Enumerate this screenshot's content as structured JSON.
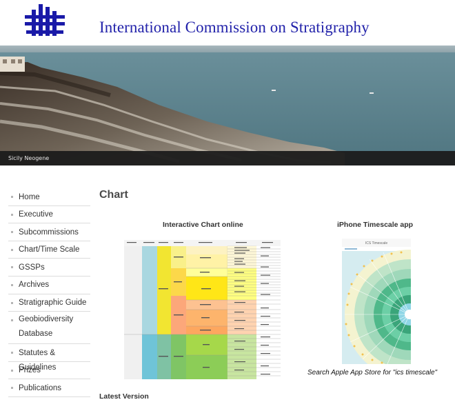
{
  "header": {
    "site_title": "International Commission on Stratigraphy"
  },
  "banner": {
    "caption": "Sicily Neogene"
  },
  "sidebar": {
    "items": [
      {
        "label": "Home"
      },
      {
        "label": "Executive"
      },
      {
        "label": "Subcommissions"
      },
      {
        "label": "Chart/Time Scale"
      },
      {
        "label": "GSSPs"
      },
      {
        "label": "Archives"
      },
      {
        "label": "Stratigraphic Guide"
      },
      {
        "label": "Geobiodiversity Database"
      },
      {
        "label": "Statutes & Guidelines"
      },
      {
        "label": "Prizes"
      },
      {
        "label": "Publications"
      }
    ]
  },
  "main": {
    "title": "Chart",
    "interactive_heading": "Interactive Chart online",
    "iphone_heading": "iPhone Timescale app",
    "app_caption": "Search Apple App Store for \"ics timescale\"",
    "app_screen_title": "ICS Timescale",
    "latest_heading": "Latest Version"
  },
  "colors": {
    "title_blue": "#2222aa",
    "nav_text": "#333333",
    "caption_bar": "#1b1b1b"
  }
}
